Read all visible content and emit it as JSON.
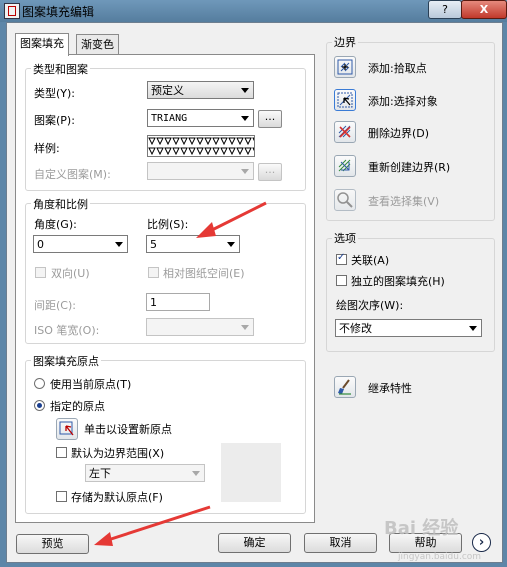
{
  "window": {
    "title": "图案填充编辑",
    "help_btn": "?",
    "close_btn": "X"
  },
  "tabs": [
    {
      "label": "图案填充"
    },
    {
      "label": "渐变色"
    }
  ],
  "type_pattern": {
    "legend": "类型和图案",
    "type_label": "类型(Y):",
    "type_value": "预定义",
    "pattern_label": "图案(P):",
    "pattern_value": "TRIANG",
    "sample_label": "样例:",
    "custom_label": "自定义图案(M):",
    "custom_value": "",
    "dots": "..."
  },
  "angle_scale": {
    "legend": "角度和比例",
    "angle_label": "角度(G):",
    "angle_value": "0",
    "scale_label": "比例(S):",
    "scale_value": "5",
    "double_label": "双向(U)",
    "paper_label": "相对图纸空间(E)",
    "spacing_label": "间距(C):",
    "spacing_value": "1",
    "iso_label": "ISO 笔宽(O):",
    "iso_value": ""
  },
  "origin": {
    "legend": "图案填充原点",
    "use_current": "使用当前原点(T)",
    "specified": "指定的原点",
    "click_set": "单击以设置新原点",
    "default_extent": "默认为边界范围(X)",
    "extent_value": "左下",
    "store_default": "存储为默认原点(F)"
  },
  "boundaries": {
    "legend": "边界",
    "add_pick": "添加:拾取点",
    "add_select": "添加:选择对象",
    "remove": "删除边界(D)",
    "recreate": "重新创建边界(R)",
    "view_set": "查看选择集(V)"
  },
  "options": {
    "legend": "选项",
    "associative": "关联(A)",
    "separate": "独立的图案填充(H)",
    "draw_order_label": "绘图次序(W):",
    "draw_order_value": "不修改"
  },
  "inherit": {
    "label": "继承特性"
  },
  "footer": {
    "preview": "预览",
    "ok": "确定",
    "cancel": "取消",
    "help": "帮助",
    "more": "›"
  },
  "watermark": {
    "text": "Bai 经验",
    "sub": "jingyan.baidu.com"
  },
  "colors": {
    "accent_red": "#e53935",
    "icon_blue": "#2f5aa8"
  }
}
